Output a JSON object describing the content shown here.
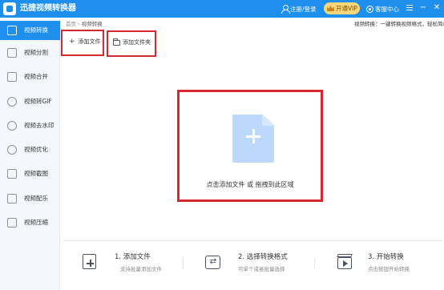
{
  "app": {
    "title": "迅捷视频转换器"
  },
  "titlebar": {
    "login_label": "注册/登录",
    "vip_label": "开通VIP",
    "service_label": "客服中心",
    "minimize_label": "−",
    "close_label": "✕"
  },
  "sidebar": {
    "items": [
      {
        "label": "视频转换",
        "icon": "video-convert-icon",
        "active": true
      },
      {
        "label": "视频分割",
        "icon": "video-split-icon",
        "active": false
      },
      {
        "label": "视频合并",
        "icon": "video-merge-icon",
        "active": false
      },
      {
        "label": "视频转GIF",
        "icon": "video-gif-icon",
        "active": false
      },
      {
        "label": "视频去水印",
        "icon": "watermark-icon",
        "active": false
      },
      {
        "label": "视频优化",
        "icon": "optimize-icon",
        "active": false
      },
      {
        "label": "视频截图",
        "icon": "screenshot-icon",
        "active": false
      },
      {
        "label": "视频配乐",
        "icon": "music-icon",
        "active": false
      },
      {
        "label": "视频压缩",
        "icon": "compress-icon",
        "active": false
      }
    ]
  },
  "breadcrumb": {
    "home": "首页",
    "separator": "›",
    "current": "视频转换"
  },
  "top_tip": "视频转换：一键转换视频格式，轻松简单",
  "toolbar": {
    "add_file_label": "添加文件",
    "add_folder_label": "添加文件夹"
  },
  "drop_zone": {
    "text": "点击添加文件 或 拖拽到此区域"
  },
  "steps": [
    {
      "title": "1. 添加文件",
      "desc": "支持批量添加文件"
    },
    {
      "title": "2. 选择转换格式",
      "desc": "可单个或者批量选择"
    },
    {
      "title": "3. 开始转换",
      "desc": "点击按钮开始转换"
    }
  ],
  "colors": {
    "accent": "#1e8fec",
    "highlight_border": "#d9272e",
    "vip": "#f7d77a"
  }
}
